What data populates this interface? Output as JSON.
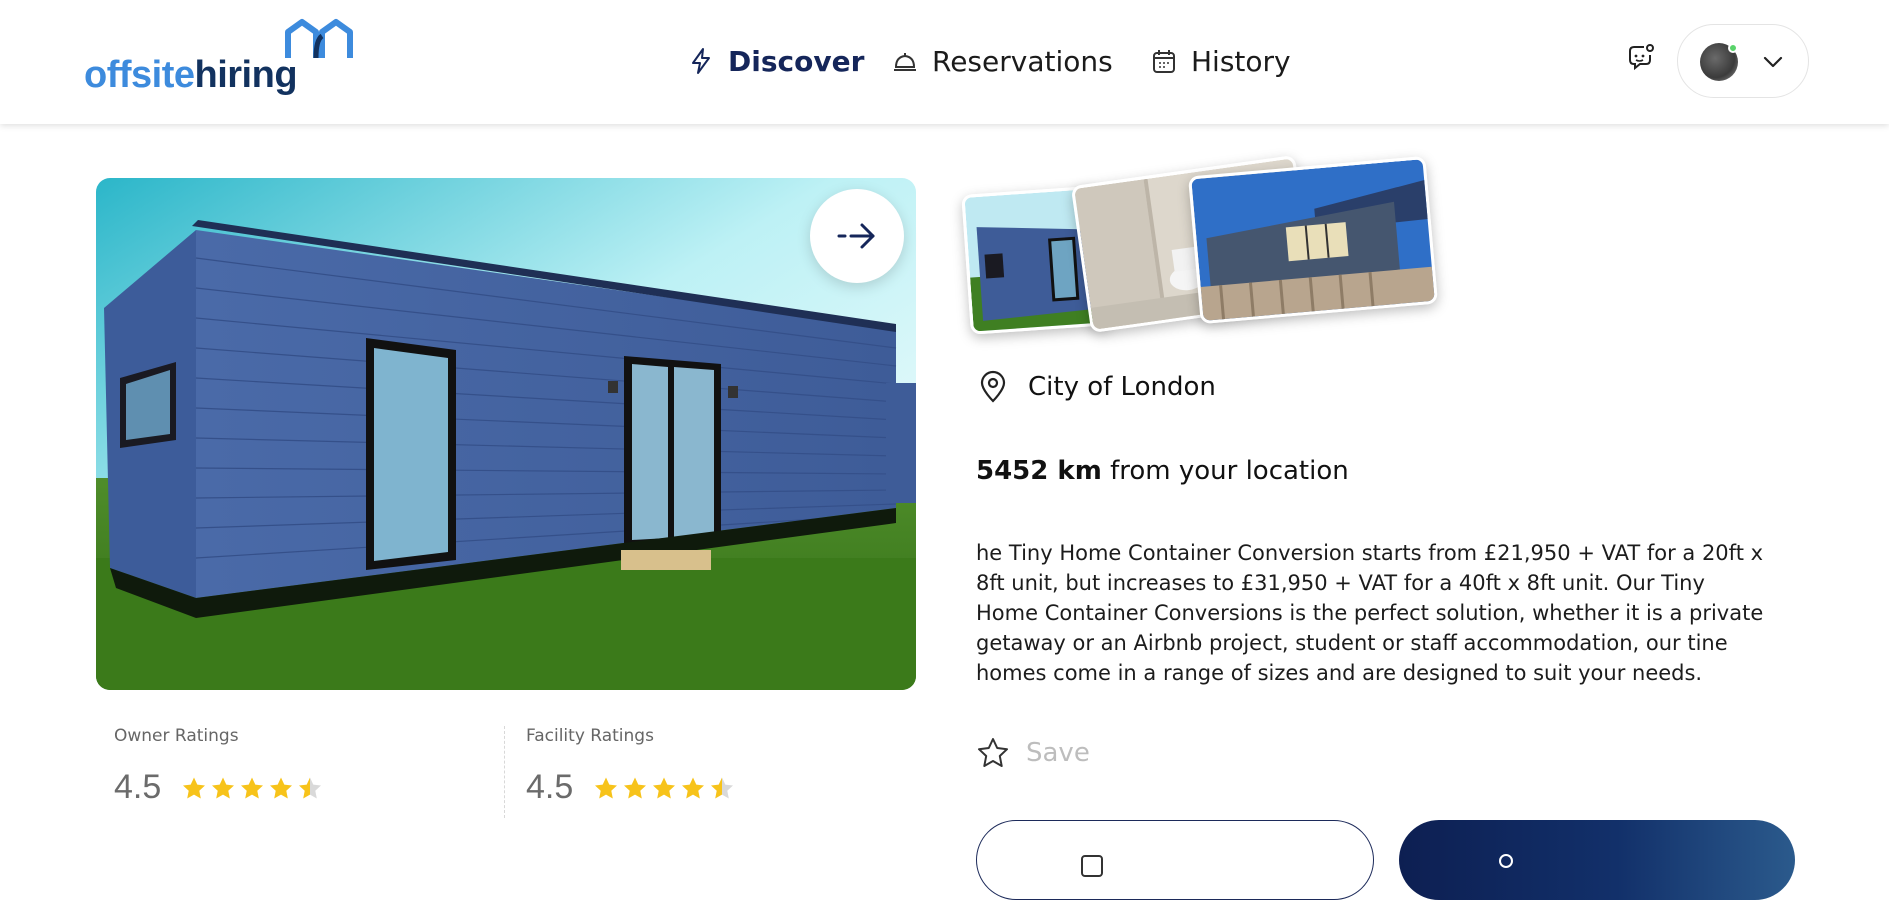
{
  "header": {
    "logo": {
      "part1": "offsite",
      "part2": "hiring"
    },
    "nav": [
      {
        "label": "Discover",
        "icon": "lightning-icon",
        "active": true
      },
      {
        "label": "Reservations",
        "icon": "bell-icon",
        "active": false
      },
      {
        "label": "History",
        "icon": "calendar-icon",
        "active": false
      }
    ]
  },
  "listing": {
    "location": "City of London",
    "distance_value": "5452 km",
    "distance_suffix": " from your location",
    "description": "he Tiny Home Container Conversion starts from £21,950 + VAT for a 20ft x 8ft unit, but increases to £31,950 + VAT for a 40ft x 8ft unit. Our Tiny Home Container Conversions is the perfect solution, whether it is a private getaway or an Airbnb project, student or staff accommodation, our tine homes come in a range of sizes and are designed to suit your needs.",
    "save_label": "Save"
  },
  "ratings": {
    "owner": {
      "title": "Owner Ratings",
      "value": "4.5",
      "stars": 4.5
    },
    "facility": {
      "title": "Facility Ratings",
      "value": "4.5",
      "stars": 4.5
    }
  },
  "colors": {
    "brand_light": "#3d8bdd",
    "brand_dark": "#12325f",
    "star": "#f7c31a",
    "star_empty": "#d9d9d9",
    "primary_button": "#0d1f52"
  }
}
